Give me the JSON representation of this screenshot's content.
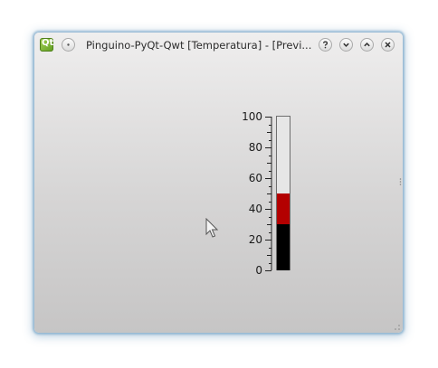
{
  "window": {
    "title": "Pinguino-PyQt-Qwt  [Temperatura] - [Previ...",
    "app_icon_text": "Qt"
  },
  "titlebar_buttons": [
    {
      "name": "help",
      "glyph": "?"
    },
    {
      "name": "minimize",
      "glyph": "chevron-down"
    },
    {
      "name": "maximize",
      "glyph": "chevron-up"
    },
    {
      "name": "close",
      "glyph": "x"
    }
  ],
  "thermometer": {
    "scale_labels": [
      "100",
      "80",
      "60",
      "40",
      "20",
      "0"
    ],
    "min": 0,
    "max": 100,
    "value": 50,
    "alarm_level": 30,
    "colors": {
      "normal": "#000000",
      "alarm": "#b30000",
      "empty": "#e6e6e6",
      "border": "#707070"
    }
  }
}
